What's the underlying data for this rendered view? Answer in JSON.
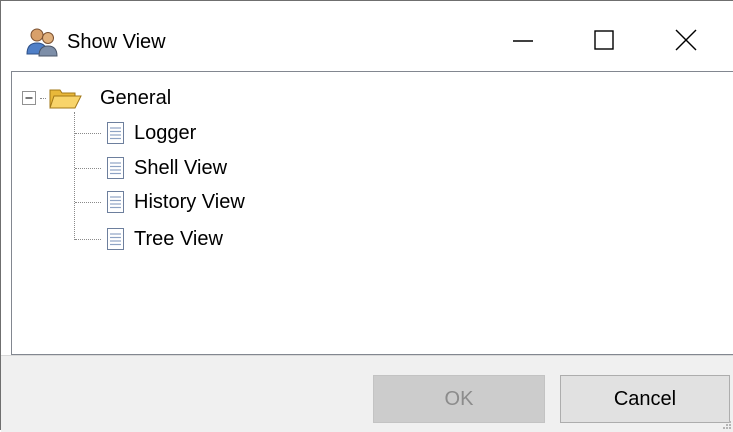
{
  "window": {
    "title": "Show View",
    "title_icon": "users-icon",
    "controls": [
      "minimize-icon",
      "maximize-icon",
      "close-icon"
    ]
  },
  "tree": {
    "root": {
      "label": "General",
      "icon": "folder-open-icon",
      "expander": "collapse-minus-icon",
      "expanded": true
    },
    "children": [
      {
        "label": "Logger",
        "icon": "document-icon"
      },
      {
        "label": "Shell View",
        "icon": "document-icon"
      },
      {
        "label": "History View",
        "icon": "document-icon"
      },
      {
        "label": "Tree View",
        "icon": "document-icon"
      }
    ]
  },
  "footer": {
    "ok_label": "OK",
    "ok_enabled": false,
    "cancel_label": "Cancel"
  },
  "colors": {
    "footer_bg": "#f0f0f0",
    "disabled_button": "#cccccc",
    "button": "#e1e1e1",
    "folder": "#f3c94a"
  }
}
